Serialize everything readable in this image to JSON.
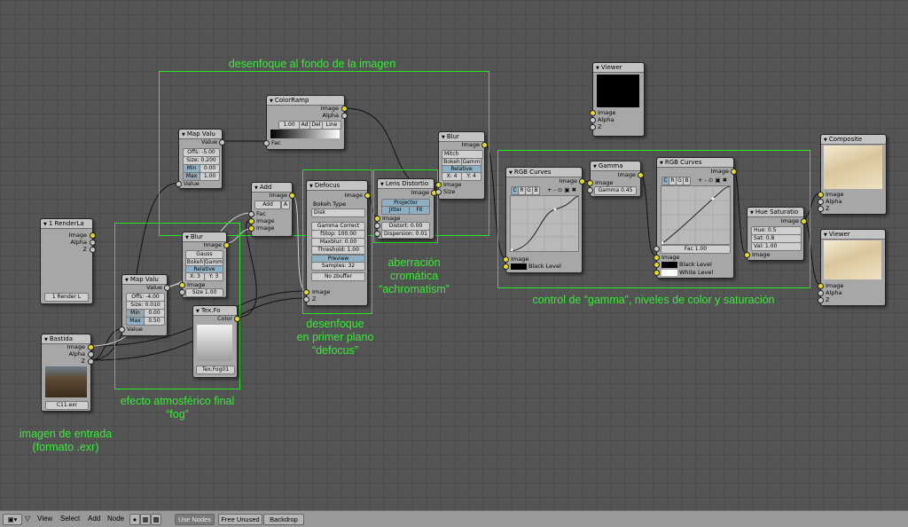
{
  "annotations": {
    "bg_blur": "desenfoque al fondo de la imagen",
    "aberration": [
      "aberración",
      "cromática",
      "“achromatism”"
    ],
    "defocus": [
      "desenfoque",
      "en primer plano",
      "“defocus”"
    ],
    "color": "control de “gamma”, niveles de color y saturación",
    "fog": [
      "efecto atmosférico final",
      "“fog”"
    ],
    "input": [
      "imagen de entrada",
      "(formato .exr)"
    ]
  },
  "nodes": {
    "render_layers": {
      "title": "1 RenderLa",
      "outputs": [
        "Image",
        "Alpha",
        "Z"
      ],
      "layer_field": "1 Render L"
    },
    "bastida": {
      "title": "Bastida",
      "outputs": [
        "Image",
        "Alpha",
        "Z"
      ],
      "file": "C11.exr"
    },
    "map_value_top": {
      "title": "Map Valu",
      "output": "Value",
      "offs": "Offs: -5.00",
      "size": "Size: 0.200",
      "min_label": "Min",
      "min_val": "0.00",
      "max_label": "Max",
      "max_val": "1.00",
      "input": "Value"
    },
    "map_value_low": {
      "title": "Map Valu",
      "output": "Value",
      "offs": "Offs: -4.00",
      "size": "Size: 0.010",
      "min_label": "Min",
      "min_val": "0.00",
      "max_label": "Max",
      "max_val": "0.50",
      "input": "Value"
    },
    "color_ramp": {
      "title": "ColorRamp",
      "outputs": [
        "Image",
        "Alpha"
      ],
      "input": "Fac",
      "pos_val": "1.00",
      "btn_add": "Ad",
      "btn_del": "Del",
      "interp": "Line"
    },
    "add": {
      "title": "Add",
      "output": "Image",
      "mode": "Add",
      "alpha_btn": "A",
      "inputs": [
        "Fac",
        "Image",
        "Image"
      ]
    },
    "blur_low": {
      "title": "Blur",
      "output": "Image",
      "filter": "Gauss",
      "bokeh": "Bokeh",
      "gamma": "Gamm",
      "relative": "Relative",
      "x": "X: 3",
      "y": "Y: 3",
      "input": "Image",
      "size": "Size 1.00"
    },
    "tex_fog": {
      "title": "Tex.Fo",
      "output": "Color",
      "tex_field": "Tex.Fog01"
    },
    "defocus": {
      "title": "Defocus",
      "output": "Image",
      "bokeh_label": "Bokeh Type",
      "bokeh_val": "Disk",
      "gamma": "Gamma Correct",
      "fstop": "fStop: 100.00",
      "maxblur": "Maxblur: 0.00",
      "threshold": "Threshold: 1.00",
      "preview": "Preview",
      "samples": "Samples: 32",
      "nozbuffer": "No zbuffer",
      "inputs": [
        "Image",
        "Z"
      ]
    },
    "lens_distortion": {
      "title": "Lens Distortio",
      "output": "Image",
      "projector": "Projector",
      "jitter": "Jitter",
      "fit": "Fit",
      "input": "Image",
      "distort": "Distort: 0.00",
      "dispersion": "Dispersion: 0.01"
    },
    "blur_top": {
      "title": "Blur",
      "output": "Image",
      "filter": "Mitch",
      "bokeh": "Bokeh",
      "gamma": "Gamm",
      "relative": "Relative",
      "x": "X: 4",
      "y": "Y: 4",
      "inputs": [
        "Image",
        "Size"
      ]
    },
    "viewer_top": {
      "title": "Viewer",
      "inputs": [
        "Image",
        "Alpha",
        "Z"
      ]
    },
    "rgb_curves_1": {
      "title": "RGB Curves",
      "output": "Image",
      "channels": [
        "C",
        "R",
        "G",
        "B"
      ],
      "inputs": [
        "Image",
        "Black Level"
      ]
    },
    "gamma": {
      "title": "Gamma",
      "output": "Image",
      "input": "Image",
      "gamma_field": "Gamma 0.45"
    },
    "rgb_curves_2": {
      "title": "RGB Curves",
      "output": "Image",
      "channels": [
        "C",
        "R",
        "G",
        "B"
      ],
      "fac": "Fac 1.00",
      "inputs": [
        "Image",
        "Black Level",
        "White Level"
      ]
    },
    "hue_sat": {
      "title": "Hue Saturatio",
      "output": "Image",
      "hue": "Hue: 0.5",
      "sat": "Sat: 0.8",
      "val": "Val: 1.00",
      "input": "Image"
    },
    "composite": {
      "title": "Composite",
      "inputs": [
        "Image",
        "Alpha",
        "Z"
      ]
    },
    "viewer_bottom": {
      "title": "Viewer",
      "inputs": [
        "Image",
        "Alpha",
        "Z"
      ]
    }
  },
  "toolbar": {
    "view": "View",
    "select": "Select",
    "add": "Add",
    "node": "Node",
    "use_nodes": "Use Nodes",
    "free_unused": "Free Unused",
    "backdrop": "Backdrop"
  },
  "colors": {
    "annotation": "#36ec36",
    "socket": "#e4dc28",
    "background": "#545454"
  }
}
